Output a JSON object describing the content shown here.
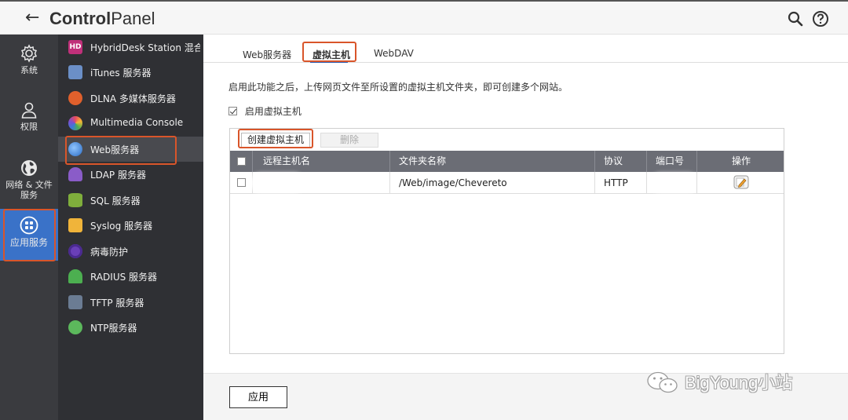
{
  "titlebar": {
    "title_bold": "Control",
    "title_rest": "Panel",
    "icons": [
      "back-arrow-icon",
      "search-icon",
      "help-icon"
    ]
  },
  "rail": {
    "items": [
      {
        "label": "系统",
        "icon": "gear-icon"
      },
      {
        "label": "权限",
        "icon": "user-icon"
      },
      {
        "label_line1": "网络 & 文件",
        "label_line2": "服务",
        "icon": "globe-icon"
      },
      {
        "label": "应用服务",
        "icon": "apps-icon",
        "active": true
      }
    ]
  },
  "sidebar": {
    "items": [
      {
        "label": "HybridDesk Station 混合…",
        "icon": "hybriddesk-icon",
        "color": "#c0307a"
      },
      {
        "label": "iTunes 服务器",
        "icon": "itunes-icon",
        "color": "#6b8fc7"
      },
      {
        "label": "DLNA 多媒体服务器",
        "icon": "dlna-icon",
        "color": "#e0602c"
      },
      {
        "label": "Multimedia Console",
        "icon": "multimedia-icon",
        "color": "#7a4fd0"
      },
      {
        "label": "Web服务器",
        "icon": "web-globe-icon",
        "color": "#3a7bd5",
        "active": true
      },
      {
        "label": "LDAP 服务器",
        "icon": "ldap-icon",
        "color": "#8a5cc8"
      },
      {
        "label": "SQL 服务器",
        "icon": "sql-icon",
        "color": "#7fae3c"
      },
      {
        "label": "Syslog 服务器",
        "icon": "syslog-icon",
        "color": "#f0b43a"
      },
      {
        "label": "病毒防护",
        "icon": "antivirus-icon",
        "color": "#6a3fb8"
      },
      {
        "label": "RADIUS 服务器",
        "icon": "radius-icon",
        "color": "#4caf50"
      },
      {
        "label": "TFTP 服务器",
        "icon": "tftp-icon",
        "color": "#6b7c93"
      },
      {
        "label": "NTP服务器",
        "icon": "ntp-icon",
        "color": "#5cb85c"
      }
    ]
  },
  "tabs": [
    {
      "label": "Web服务器"
    },
    {
      "label": "虚拟主机",
      "active": true
    },
    {
      "label": "WebDAV"
    }
  ],
  "content": {
    "description": "启用此功能之后，上传网页文件至所设置的虚拟主机文件夹，即可创建多个网站。",
    "enable_checkbox_label": "启用虚拟主机",
    "enable_checked": true,
    "create_button": "创建虚拟主机",
    "delete_button": "删除",
    "table": {
      "columns": [
        "远程主机名",
        "文件夹名称",
        "协议",
        "端口号",
        "操作"
      ],
      "rows": [
        {
          "host": "",
          "folder": "/Web/image/Chevereto",
          "protocol": "HTTP",
          "port": "",
          "action_icon": "edit-icon"
        }
      ]
    },
    "apply_button": "应用"
  },
  "watermark": {
    "text": "BigYoung小站",
    "icon": "wechat-icon"
  },
  "colors": {
    "accent": "#3a72c8",
    "highlight": "#d9552a",
    "rail_bg": "#3a3b3f",
    "sidebar_bg": "#2f3034",
    "table_header": "#6b6d75"
  }
}
